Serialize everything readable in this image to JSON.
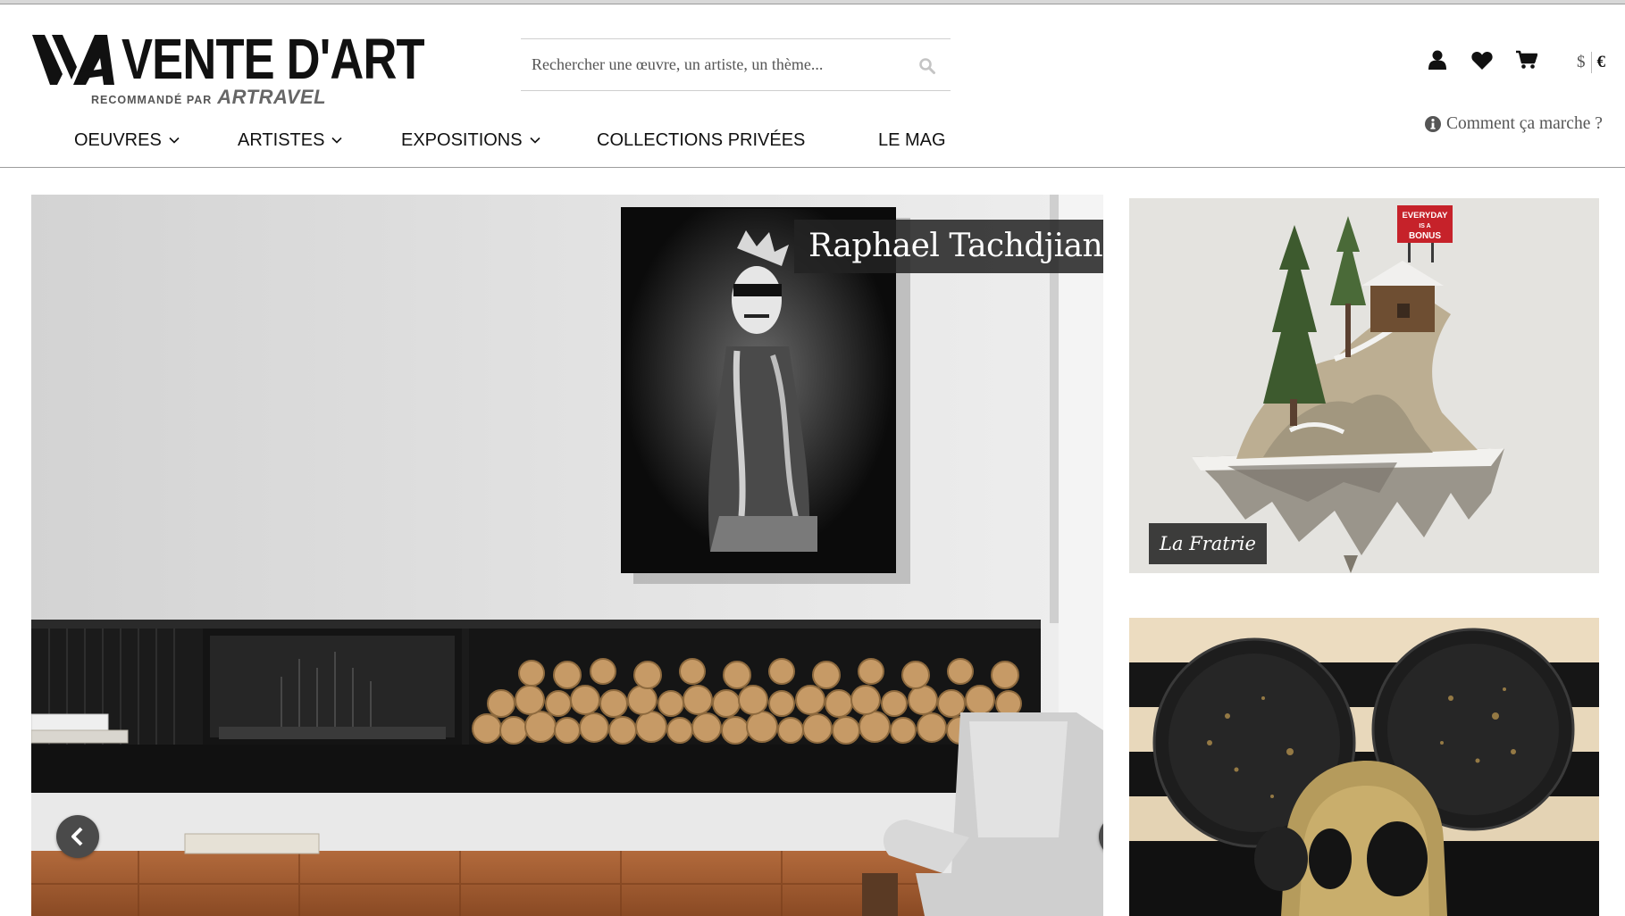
{
  "brand": {
    "name": "VENTE D'ART",
    "tagline_prefix": "RECOMMANDÉ PAR",
    "tagline_brand": "ARTRAVEL"
  },
  "search": {
    "placeholder": "Rechercher une œuvre, un artiste, un thème...",
    "value": ""
  },
  "header_icons": [
    "user-icon",
    "heart-icon",
    "cart-icon",
    "search-icon",
    "info-icon"
  ],
  "currency": {
    "options": [
      "$",
      "€"
    ],
    "selected": "€"
  },
  "help_link": "Comment ça marche ?",
  "nav": [
    {
      "label": "OEUVRES",
      "has_dropdown": true
    },
    {
      "label": "ARTISTES",
      "has_dropdown": true
    },
    {
      "label": "EXPOSITIONS",
      "has_dropdown": true
    },
    {
      "label": "COLLECTIONS PRIVÉES",
      "has_dropdown": false
    },
    {
      "label": "LE MAG",
      "has_dropdown": false
    }
  ],
  "hero": {
    "caption": "Raphael Tachdjian",
    "prev_icon": "chevron-left-icon",
    "next_icon": "chevron-right-icon"
  },
  "side_cards": [
    {
      "caption": "La Fratrie",
      "sign_text": "EVERYDAY IS A BONUS"
    },
    {
      "caption": ""
    }
  ],
  "colors": {
    "text": "#111111",
    "muted": "#555555",
    "caption_bg": "#232323",
    "arrow_bg": "#4a4a4a",
    "divider": "#9c9c9c"
  }
}
